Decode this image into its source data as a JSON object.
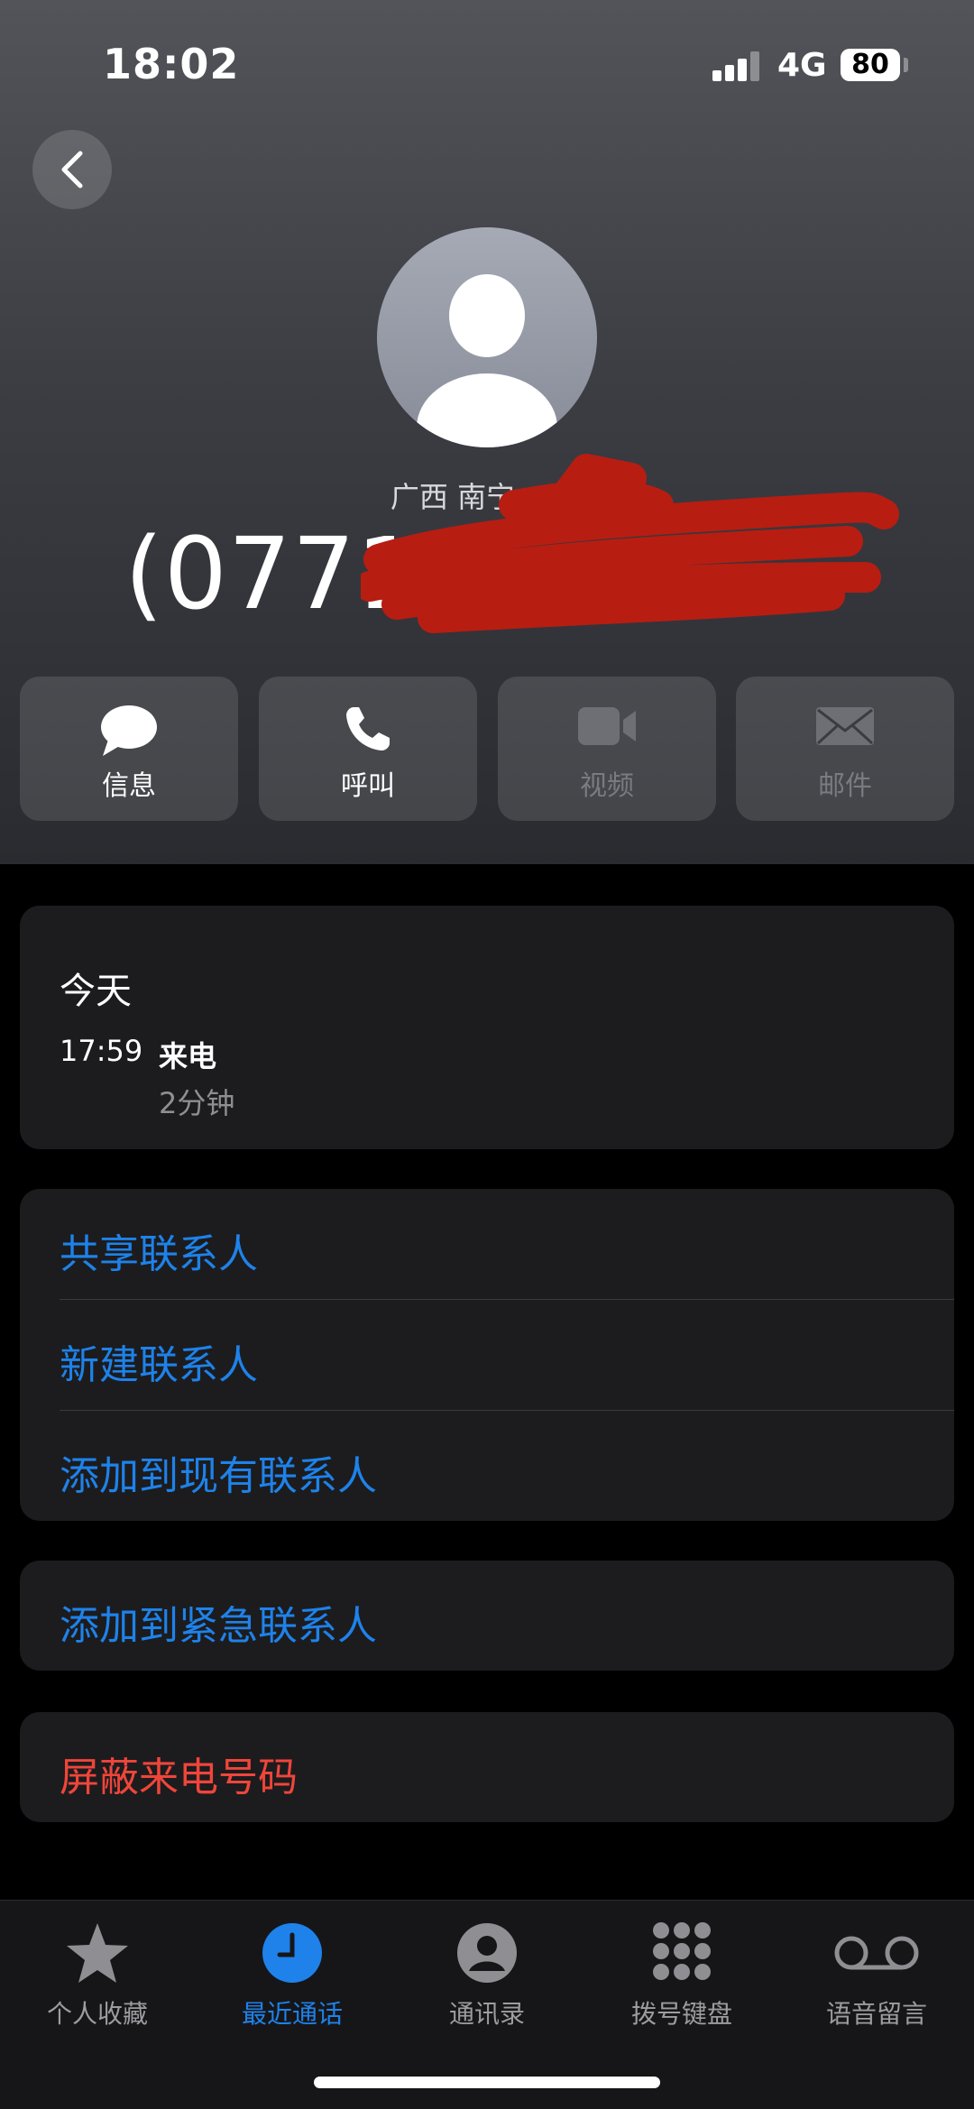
{
  "status_bar": {
    "time": "18:02",
    "network": "4G",
    "battery": "80"
  },
  "contact": {
    "location": "广西 南宁",
    "number": "(0771)"
  },
  "actions": [
    {
      "label": "信息",
      "icon": "message-icon",
      "enabled": true
    },
    {
      "label": "呼叫",
      "icon": "phone-icon",
      "enabled": true
    },
    {
      "label": "视频",
      "icon": "video-icon",
      "enabled": false
    },
    {
      "label": "邮件",
      "icon": "mail-icon",
      "enabled": false
    }
  ],
  "recent_calls": {
    "day": "今天",
    "entries": [
      {
        "time": "17:59",
        "type": "来电",
        "duration": "2分钟"
      }
    ]
  },
  "options": {
    "share": "共享联系人",
    "new": "新建联系人",
    "add_existing": "添加到现有联系人",
    "add_emergency": "添加到紧急联系人",
    "block": "屏蔽来电号码"
  },
  "tabs": [
    {
      "label": "个人收藏",
      "icon": "star-icon",
      "active": false
    },
    {
      "label": "最近通话",
      "icon": "clock-icon",
      "active": true
    },
    {
      "label": "通讯录",
      "icon": "contacts-icon",
      "active": false
    },
    {
      "label": "拨号键盘",
      "icon": "keypad-icon",
      "active": false
    },
    {
      "label": "语音留言",
      "icon": "voicemail-icon",
      "active": false
    }
  ],
  "colors": {
    "accent": "#1e82ea",
    "destructive": "#f0453a",
    "redaction": "#b81d12"
  }
}
